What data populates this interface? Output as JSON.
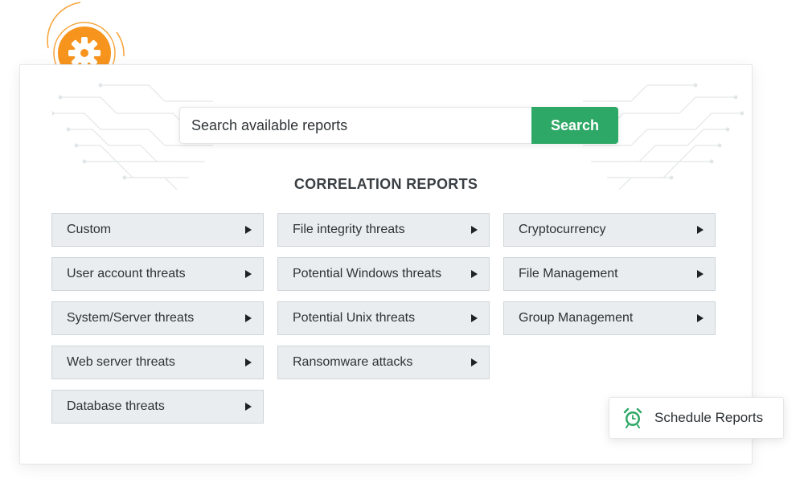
{
  "search": {
    "placeholder": "Search available reports",
    "button_label": "Search"
  },
  "section_title": "CORRELATION REPORTS",
  "reports": {
    "col0": [
      "Custom",
      "User account threats",
      "System/Server threats",
      "Web server threats",
      "Database threats"
    ],
    "col1": [
      "File integrity threats",
      "Potential Windows threats",
      "Potential Unix threats",
      "Ransomware attacks"
    ],
    "col2": [
      "Cryptocurrency",
      "File Management",
      "Group Management"
    ]
  },
  "schedule": {
    "label": "Schedule Reports",
    "icon": "alarm-clock-icon"
  },
  "badge": {
    "icon": "gear-icon"
  },
  "colors": {
    "accent_green": "#2ea866",
    "badge_orange": "#f7941d",
    "button_bg": "#e9edf0"
  }
}
